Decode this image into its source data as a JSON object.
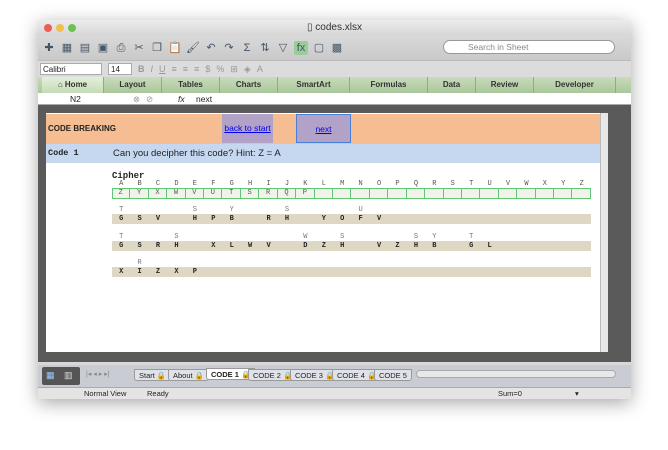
{
  "window": {
    "title": "codes.xlsx"
  },
  "search": {
    "placeholder": "Search in Sheet"
  },
  "format": {
    "font": "Calibri",
    "size": "14"
  },
  "ribbon": [
    "Home",
    "Layout",
    "Tables",
    "Charts",
    "SmartArt",
    "Formulas",
    "Data",
    "Review",
    "Developer"
  ],
  "formula": {
    "cell_ref": "N2",
    "fx": "fx",
    "value": "next"
  },
  "sheet": {
    "heading": "CODE BREAKING",
    "back_link": "back to start",
    "next_link": "next",
    "code_label": "Code 1",
    "prompt": "Can you decipher this code? Hint: Z = A",
    "cipher_label": "Cipher",
    "alphabet": [
      "A",
      "B",
      "C",
      "D",
      "E",
      "F",
      "G",
      "H",
      "I",
      "J",
      "K",
      "L",
      "M",
      "N",
      "O",
      "P",
      "Q",
      "R",
      "S",
      "T",
      "U",
      "V",
      "W",
      "X",
      "Y",
      "Z"
    ],
    "key": [
      "Z",
      "Y",
      "X",
      "W",
      "V",
      "U",
      "T",
      "S",
      "R",
      "Q",
      "P",
      "",
      "",
      "",
      "",
      "",
      "",
      "",
      "",
      "",
      "",
      "",
      "",
      "",
      "",
      ""
    ],
    "lines": [
      {
        "hints": [
          "T",
          "",
          "",
          "",
          "S",
          "",
          "Y",
          "",
          "",
          "S",
          "",
          "",
          "",
          "U"
        ],
        "letters": [
          "G",
          "S",
          "V",
          "",
          "H",
          "P",
          "B",
          "",
          "R",
          "H",
          "",
          "Y",
          "O",
          "F",
          "V"
        ]
      },
      {
        "hints": [
          "T",
          "",
          "",
          "S",
          "",
          "",
          "",
          "",
          "",
          "",
          "W",
          "",
          "S",
          "",
          "",
          "",
          "S",
          "Y",
          "",
          "T"
        ],
        "letters": [
          "G",
          "S",
          "R",
          "H",
          "",
          "X",
          "L",
          "W",
          "V",
          "",
          "D",
          "Z",
          "H",
          "",
          "V",
          "Z",
          "H",
          "B",
          "",
          "G",
          "L"
        ]
      },
      {
        "hints": [
          "",
          "R"
        ],
        "letters": [
          "X",
          "I",
          "Z",
          "X",
          "P"
        ]
      }
    ]
  },
  "sheet_tabs": [
    "Start",
    "About",
    "CODE 1",
    "CODE 2",
    "CODE 3",
    "CODE 4",
    "CODE 5"
  ],
  "active_tab": "CODE 1",
  "status": {
    "view": "Normal View",
    "state": "Ready",
    "sum": "Sum=0"
  },
  "colors": {
    "orange": "#f6bd93",
    "blue": "#c5d8ef",
    "purple": "#b3a2c7",
    "bar": "#ddd7c4",
    "grid": "#5fc873"
  }
}
